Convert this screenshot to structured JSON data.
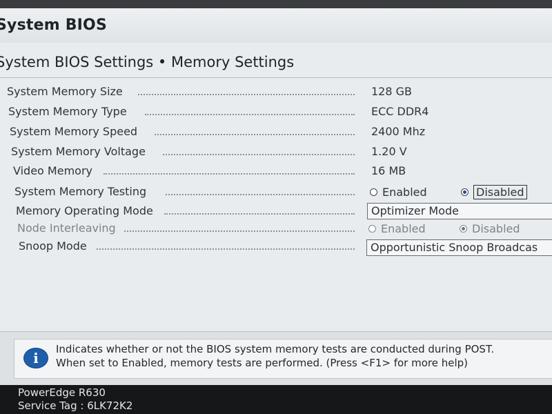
{
  "header": {
    "title": "System BIOS"
  },
  "page": {
    "title": "System BIOS Settings • Memory Settings"
  },
  "settings": [
    {
      "label": "System Memory Size",
      "value": "128 GB"
    },
    {
      "label": "System Memory Type",
      "value": "ECC DDR4"
    },
    {
      "label": "System Memory Speed",
      "value": "2400 Mhz"
    },
    {
      "label": "System Memory Voltage",
      "value": "1.20 V"
    },
    {
      "label": "Video Memory",
      "value": "16 MB"
    },
    {
      "label": "System Memory Testing",
      "options": [
        "Enabled",
        "Disabled"
      ],
      "selected": "Disabled"
    },
    {
      "label": "Memory Operating Mode",
      "value": "Optimizer Mode"
    },
    {
      "label": "Node Interleaving",
      "options": [
        "Enabled",
        "Disabled"
      ],
      "selected": "Disabled",
      "disabled": true
    },
    {
      "label": "Snoop Mode",
      "value": "Opportunistic Snoop Broadcas"
    }
  ],
  "help": {
    "line1": "Indicates whether or not the BIOS system memory tests are conducted during POST.",
    "line2": "When set to Enabled, memory tests are performed. (Press <F1> for more help)"
  },
  "footer": {
    "model": "PowerEdge R630",
    "service_tag": "Service Tag : 6LK72K2"
  },
  "icons": {
    "info": "info-icon"
  },
  "colors": {
    "info_icon": "#1f5eab",
    "footer_bg": "#151719",
    "content_bg": "#e9ecee"
  }
}
